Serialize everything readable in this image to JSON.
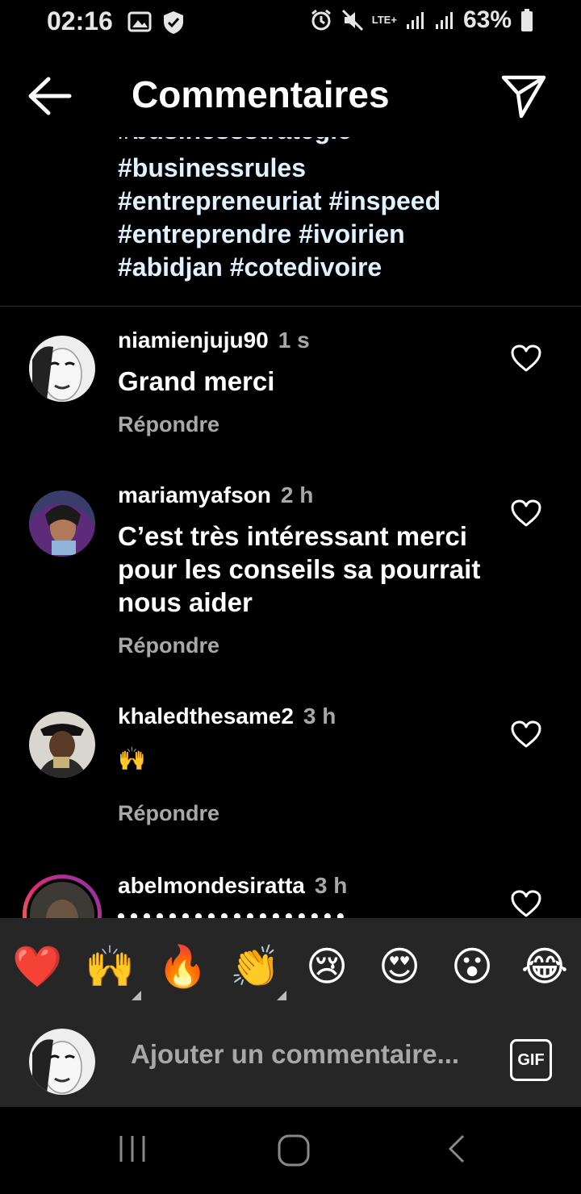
{
  "status_bar": {
    "time": "02:16",
    "network": "LTE+",
    "battery": "63%"
  },
  "header": {
    "title": "Commentaires"
  },
  "caption": {
    "partial_line": "#businessstrategie",
    "lines": [
      "#businessrules",
      "#entrepreneuriat #inspeed",
      "#entreprendre #ivoirien",
      "#abidjan #cotedivoire"
    ]
  },
  "comments": [
    {
      "username": "niamienjuju90",
      "time": "1 s",
      "text": "Grand merci",
      "reply": "Répondre"
    },
    {
      "username": "mariamyafson",
      "time": "2 h",
      "text": "C’est très intéressant merci pour les conseils sa pourrait nous aider",
      "reply": "Répondre"
    },
    {
      "username": "khaledthesame2",
      "time": "3 h",
      "text": "🙌",
      "reply": "Répondre"
    },
    {
      "username": "abelmondesiratta",
      "time": "3 h"
    }
  ],
  "emoji_bar": [
    "❤️",
    "🙌",
    "🔥",
    "👏",
    "😢",
    "😍",
    "😮",
    "😂"
  ],
  "input": {
    "placeholder": "Ajouter un commentaire...",
    "gif_label": "GIF"
  },
  "colors": {
    "background": "#000000",
    "panel": "#262626",
    "hashtag": "#e0f1ff",
    "secondary_text": "#a8a8a8"
  }
}
